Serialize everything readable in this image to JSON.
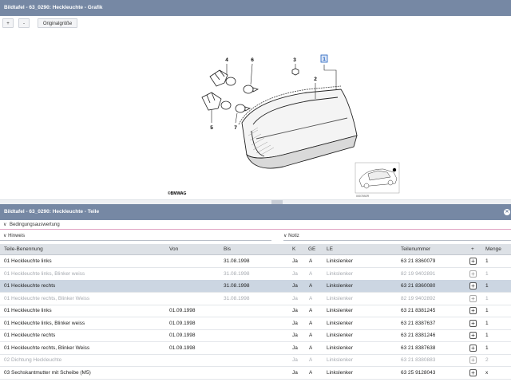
{
  "graphic_panel": {
    "title": "Bildtafel - 63_0290: Heckleuchte - Grafik",
    "zoom_in_label": "+",
    "zoom_out_label": "-",
    "original_size_label": "Originalgröße",
    "callouts": [
      "4",
      "6",
      "3",
      "1",
      "2",
      "5",
      "7"
    ],
    "brand_text": "©BMWAG",
    "drawing_number": "0007892R"
  },
  "parts_panel": {
    "title": "Bildtafel - 63_0290: Heckleuchte - Teile",
    "condition_label": "Bedingungsauswertung",
    "hinweis_label": "Hinweis",
    "notiz_label": "Notiz",
    "columns": {
      "name": "Teile-Benennung",
      "von": "Von",
      "bis": "Bis",
      "k": "K",
      "ge": "GE",
      "le": "LE",
      "teilenummer": "Teilenummer",
      "add": "+",
      "menge": "Menge"
    },
    "rows": [
      {
        "name": "01 Heckleuchte links",
        "von": "",
        "bis": "31.08.1998",
        "k": "Ja",
        "ge": "A",
        "le": "Linkslenker",
        "nr": "63 21 8360079",
        "menge": "1"
      },
      {
        "name": "01 Heckleuchte links, Blinker weiss",
        "von": "",
        "bis": "31.08.1998",
        "k": "Ja",
        "ge": "A",
        "le": "Linkslenker",
        "nr": "82 19 9402891",
        "menge": "1"
      },
      {
        "name": "01 Heckleuchte rechts",
        "von": "",
        "bis": "31.08.1998",
        "k": "Ja",
        "ge": "A",
        "le": "Linkslenker",
        "nr": "63 21 8360080",
        "menge": "1"
      },
      {
        "name": "01 Heckleuchte rechts, Blinker Weiss",
        "von": "",
        "bis": "31.08.1998",
        "k": "Ja",
        "ge": "A",
        "le": "Linkslenker",
        "nr": "82 19 9402892",
        "menge": "1"
      },
      {
        "name": "01 Heckleuchte links",
        "von": "01.09.1998",
        "bis": "",
        "k": "Ja",
        "ge": "A",
        "le": "Linkslenker",
        "nr": "63 21 8381245",
        "menge": "1"
      },
      {
        "name": "01 Heckleuchte links, Blinker weiss",
        "von": "01.09.1998",
        "bis": "",
        "k": "Ja",
        "ge": "A",
        "le": "Linkslenker",
        "nr": "63 21 8387637",
        "menge": "1"
      },
      {
        "name": "01 Heckleuchte rechts",
        "von": "01.09.1998",
        "bis": "",
        "k": "Ja",
        "ge": "A",
        "le": "Linkslenker",
        "nr": "63 21 8381246",
        "menge": "1"
      },
      {
        "name": "01 Heckleuchte rechts, Blinker Weiss",
        "von": "01.09.1998",
        "bis": "",
        "k": "Ja",
        "ge": "A",
        "le": "Linkslenker",
        "nr": "63 21 8387638",
        "menge": "1"
      },
      {
        "name": "02 Dichtung Heckleuchte",
        "von": "",
        "bis": "",
        "k": "Ja",
        "ge": "A",
        "le": "Linkslenker",
        "nr": "63 21 8380883",
        "menge": "2"
      },
      {
        "name": "03 Sechskantmutter mit Scheibe (M5)",
        "von": "",
        "bis": "",
        "k": "Ja",
        "ge": "A",
        "le": "Linkslenker",
        "nr": "63 25 9128043",
        "menge": "x"
      }
    ]
  },
  "colors": {
    "titlebar": "#7688a4",
    "header_row": "#dde1e6",
    "selected_row": "#ccd6e2",
    "callout_highlight": "#1f5fbf"
  }
}
